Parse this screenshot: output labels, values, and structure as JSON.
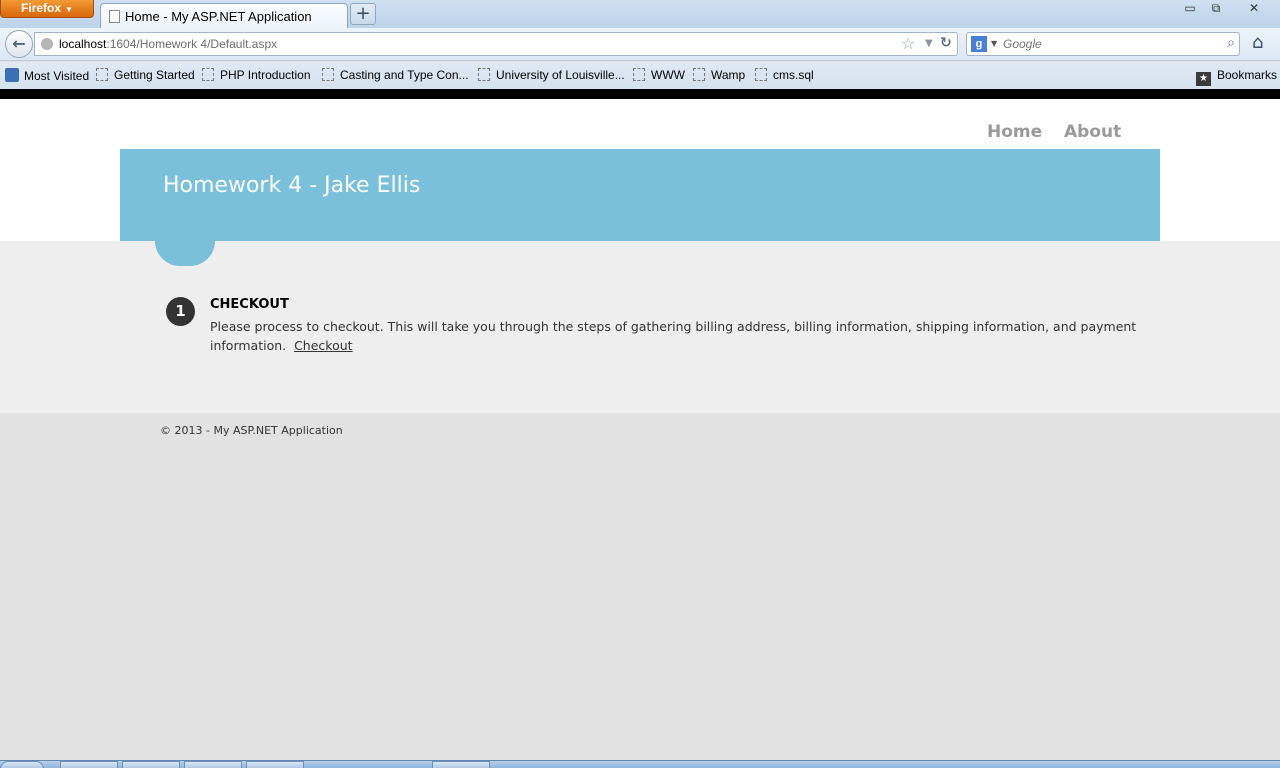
{
  "browser": {
    "menu_button": "Firefox",
    "tab_title": "Home - My ASP.NET Application",
    "url_host": "localhost",
    "url_rest": ":1604/Homework 4/Default.aspx",
    "search_placeholder": "Google",
    "bookmarks": [
      "Most Visited",
      "Getting Started",
      "PHP Introduction",
      "Casting and Type Con...",
      "University of Louisville...",
      "WWW",
      "Wamp",
      "cms.sql"
    ],
    "bookmarks_menu": "Bookmarks"
  },
  "site": {
    "nav": {
      "home": "Home",
      "about": "About"
    },
    "title": "Homework 4 - Jake Ellis",
    "step": {
      "number": "1",
      "heading": "CHECKOUT",
      "text": "Please process to checkout. This will take you through the steps of gathering billing address, billing information, shipping information, and payment information.",
      "link": "Checkout"
    },
    "footer": "© 2013 - My ASP.NET Application"
  },
  "colors": {
    "featured": "#7ac0da",
    "main_bg": "#efeeef",
    "footer_bg": "#e2e2e2",
    "nav_link": "#999999"
  }
}
